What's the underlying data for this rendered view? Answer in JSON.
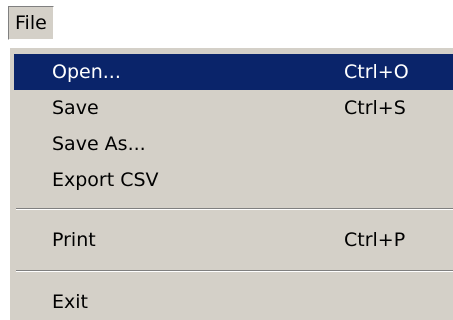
{
  "menubar": {
    "file_label": "File"
  },
  "menu": {
    "items": [
      {
        "label": "Open...",
        "shortcut": "Ctrl+O",
        "selected": true
      },
      {
        "label": "Save",
        "shortcut": "Ctrl+S"
      },
      {
        "label": "Save As...",
        "shortcut": ""
      },
      {
        "label": "Export CSV",
        "shortcut": ""
      },
      {
        "label": "Print",
        "shortcut": "Ctrl+P"
      },
      {
        "label": "Exit",
        "shortcut": ""
      }
    ]
  },
  "colors": {
    "menu_background": "#d4d0c8",
    "selection_background": "#0a246a",
    "selection_text": "#ffffff"
  }
}
